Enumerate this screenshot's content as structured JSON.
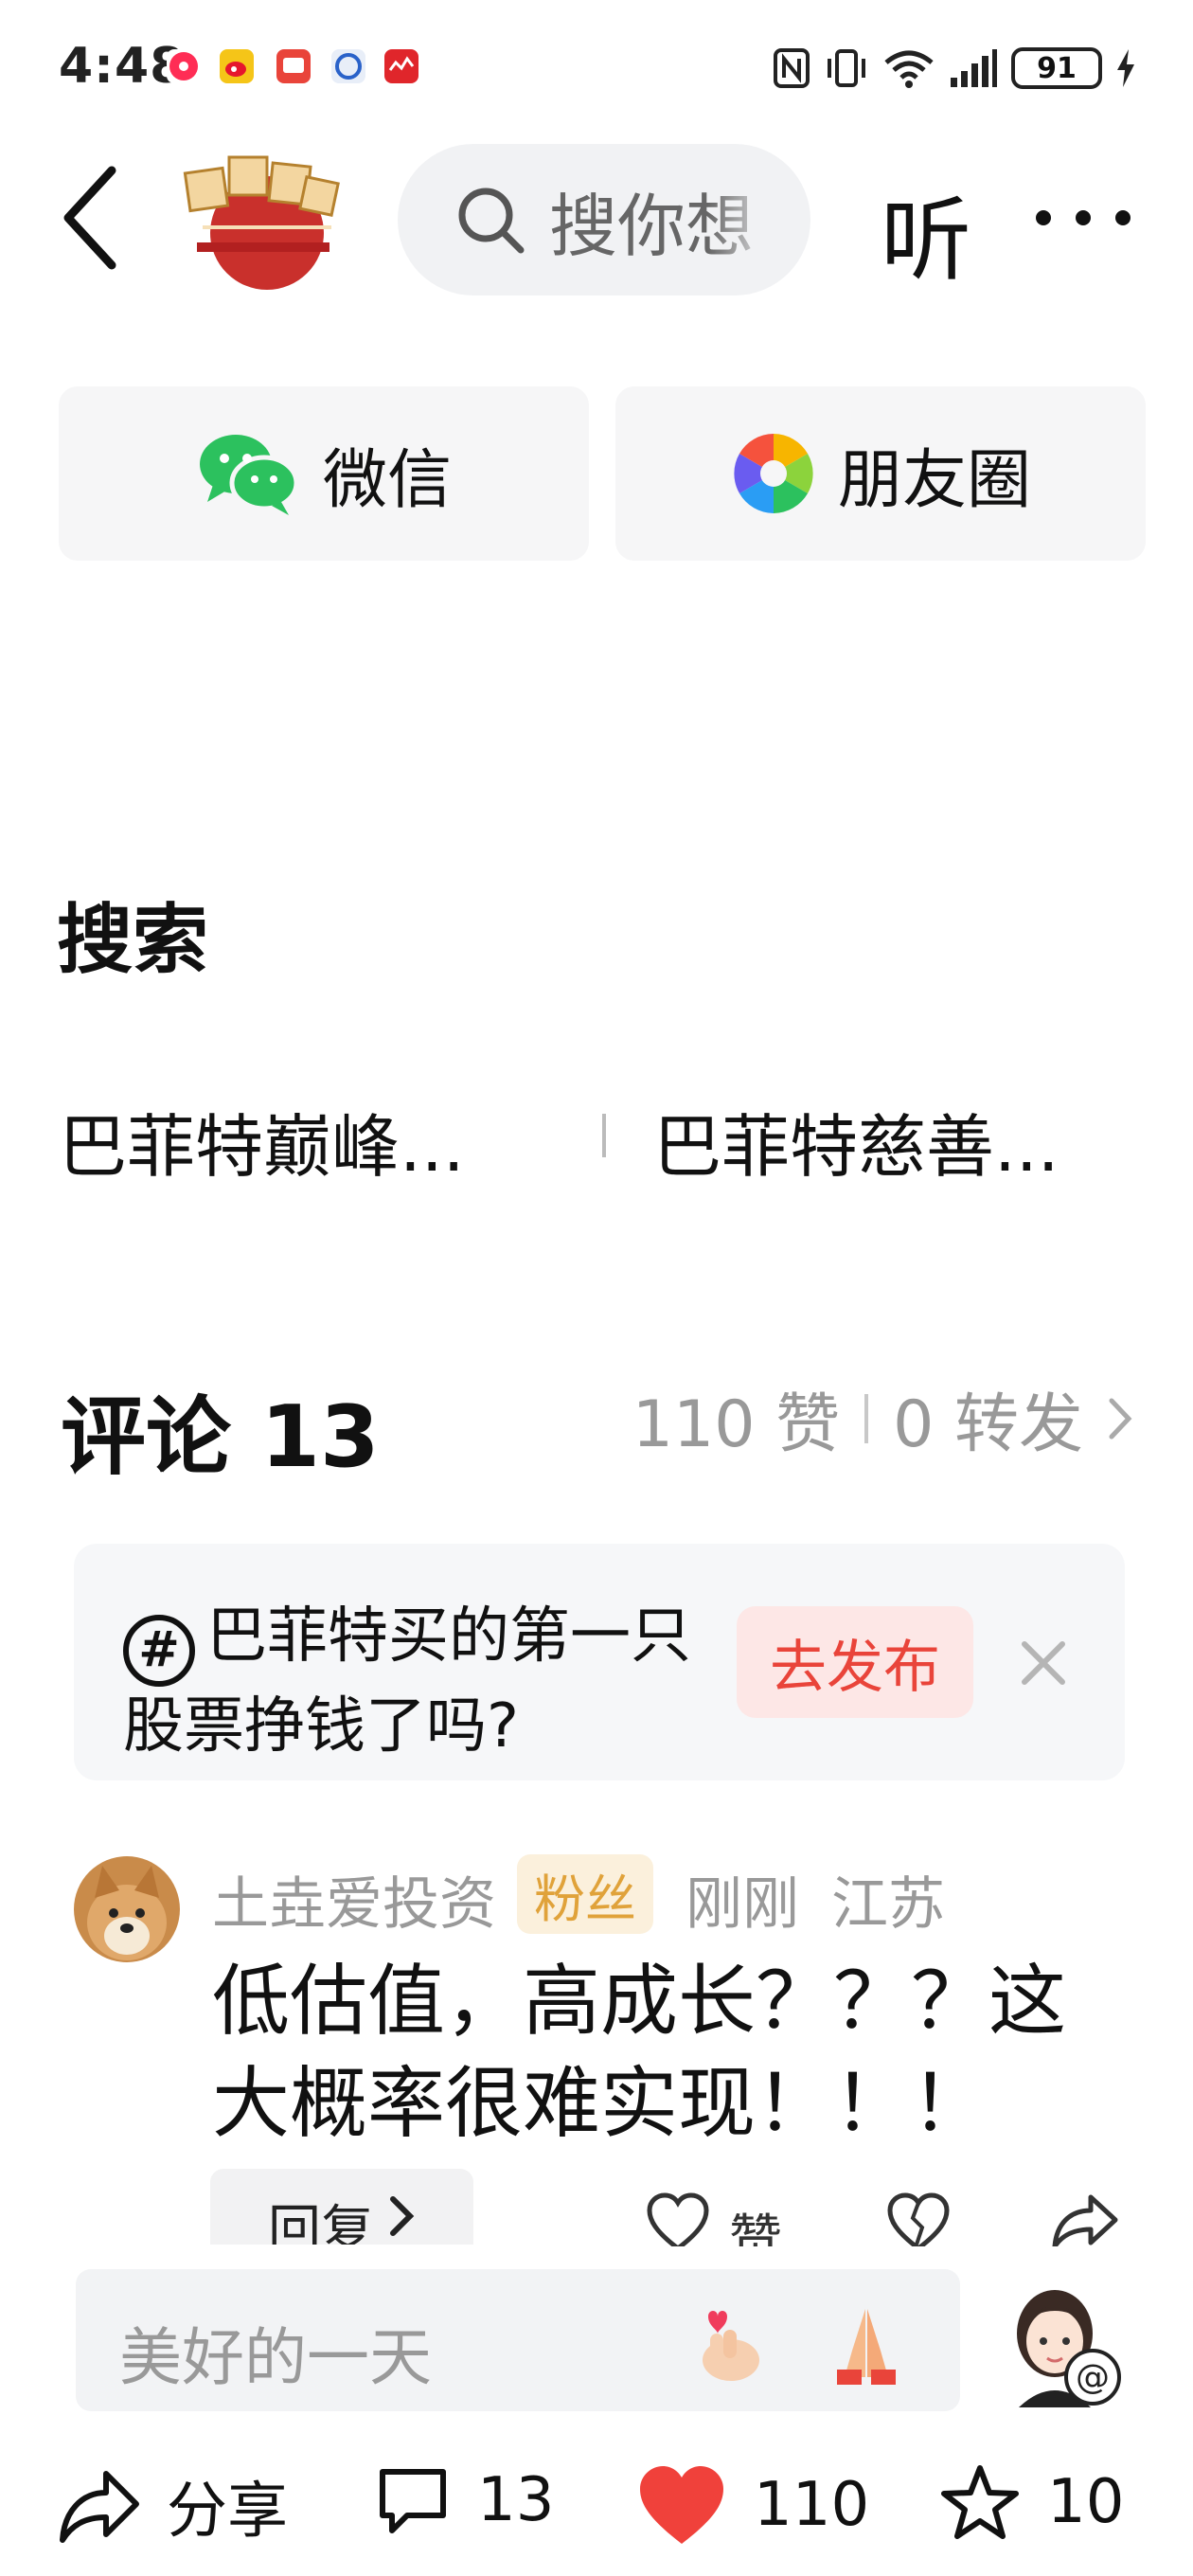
{
  "status_bar": {
    "time": "4:48",
    "battery": "91"
  },
  "header": {
    "search_placeholder": "搜你想",
    "listen_label": "听"
  },
  "share": {
    "wechat_label": "微信",
    "moments_label": "朋友圈"
  },
  "search_section": {
    "title": "搜索",
    "items": [
      "巴菲特巅峰...",
      "巴菲特慈善..."
    ]
  },
  "comments_header": {
    "title": "评论 13",
    "likes": "110 赞",
    "reposts": "0 转发"
  },
  "topic": {
    "text": "巴菲特买的第一只股票挣钱了吗?",
    "publish_label": "去发布"
  },
  "comment": {
    "author": "土垚爱投资",
    "badge": "粉丝",
    "time": "刚刚",
    "location": "江苏",
    "body": "低估值，高成长？？？这大概率很难实现！！！",
    "reply_label": "回复",
    "like_label": "赞"
  },
  "input": {
    "placeholder": "美好的一天"
  },
  "toolbar": {
    "share_label": "分享",
    "comments_count": "13",
    "likes_count": "110",
    "favorites_count": "10"
  },
  "colors": {
    "accent_red": "#e9443a",
    "heart_red": "#f0413b",
    "fan_badge_bg": "#fbf0dc",
    "fan_badge_text": "#e0a23a",
    "muted_text": "#999999"
  }
}
